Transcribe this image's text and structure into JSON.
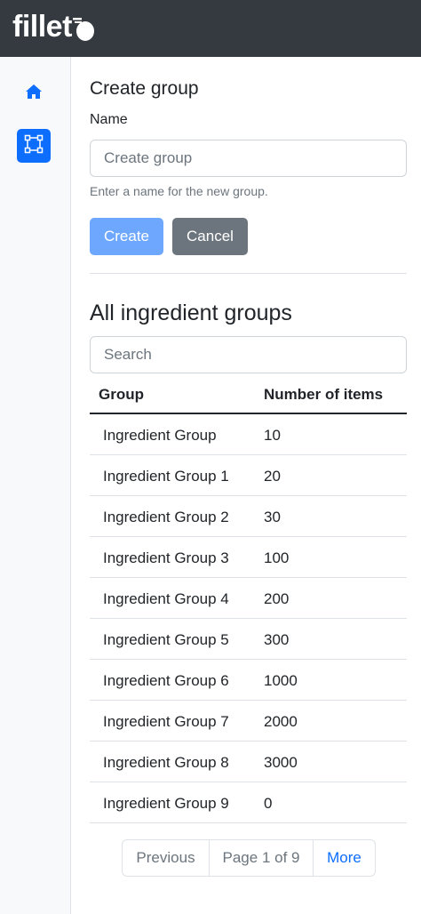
{
  "app": {
    "logo_text": "fillet"
  },
  "sidebar": {
    "items": [
      {
        "icon": "home-icon",
        "active": false
      },
      {
        "icon": "groups-icon",
        "active": true
      }
    ],
    "accent": "#0d6efd"
  },
  "create_form": {
    "title": "Create group",
    "name_label": "Name",
    "name_placeholder": "Create group",
    "name_value": "",
    "help_text": "Enter a name for the new group.",
    "create_label": "Create",
    "cancel_label": "Cancel"
  },
  "groups": {
    "title": "All ingredient groups",
    "search_placeholder": "Search",
    "columns": [
      "Group",
      "Number of items"
    ],
    "rows": [
      {
        "name": "Ingredient Group",
        "count": "10"
      },
      {
        "name": "Ingredient Group 1",
        "count": "20"
      },
      {
        "name": "Ingredient Group 2",
        "count": "30"
      },
      {
        "name": "Ingredient Group 3",
        "count": "100"
      },
      {
        "name": "Ingredient Group 4",
        "count": "200"
      },
      {
        "name": "Ingredient Group 5",
        "count": "300"
      },
      {
        "name": "Ingredient Group 6",
        "count": "1000"
      },
      {
        "name": "Ingredient Group 7",
        "count": "2000"
      },
      {
        "name": "Ingredient Group 8",
        "count": "3000"
      },
      {
        "name": "Ingredient Group 9",
        "count": "0"
      }
    ]
  },
  "pagination": {
    "previous_label": "Previous",
    "page_info": "Page 1 of 9",
    "more_label": "More"
  }
}
